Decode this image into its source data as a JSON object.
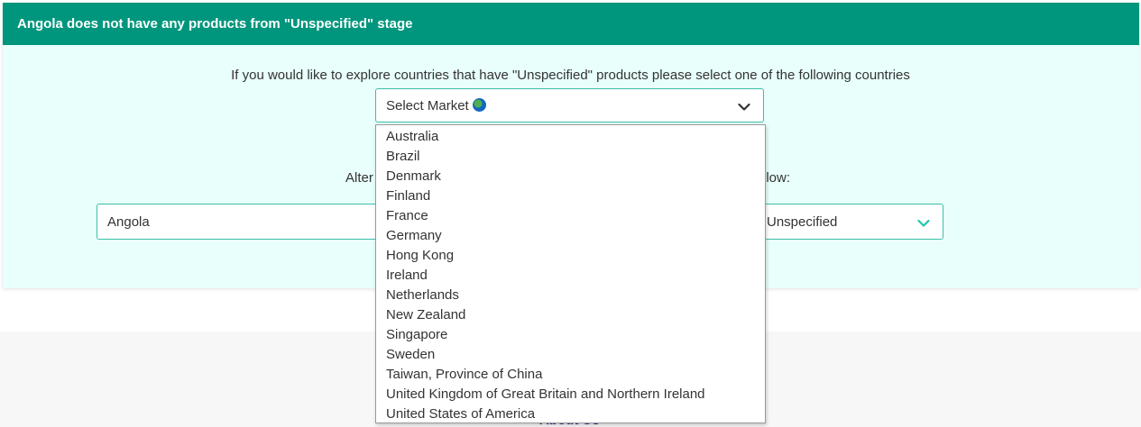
{
  "header": {
    "title": "Angola does not have any products from \"Unspecified\" stage"
  },
  "explore": {
    "prompt": "If you would like to explore countries that have \"Unspecified\" products please select one of the following countries",
    "market_select": {
      "label": "Select Market",
      "icon": "globe-icon"
    },
    "options": [
      "Australia",
      "Brazil",
      "Denmark",
      "Finland",
      "France",
      "Germany",
      "Hong Kong",
      "Ireland",
      "Netherlands",
      "New Zealand",
      "Singapore",
      "Sweden",
      "Taiwan, Province of China",
      "United Kingdom of Great Britain and Northern Ireland",
      "United States of America"
    ]
  },
  "alternative": {
    "text_left_visible": "Alter",
    "text_right_visible": "elow:",
    "country_value": "Angola",
    "stage_value": "Unspecified"
  },
  "footer": {
    "link": "About Us"
  },
  "colors": {
    "header_bg": "#00967d",
    "panel_bg": "#e8fffb",
    "accent": "#3bbfa8",
    "chevron_accent": "#1fc7a8"
  }
}
